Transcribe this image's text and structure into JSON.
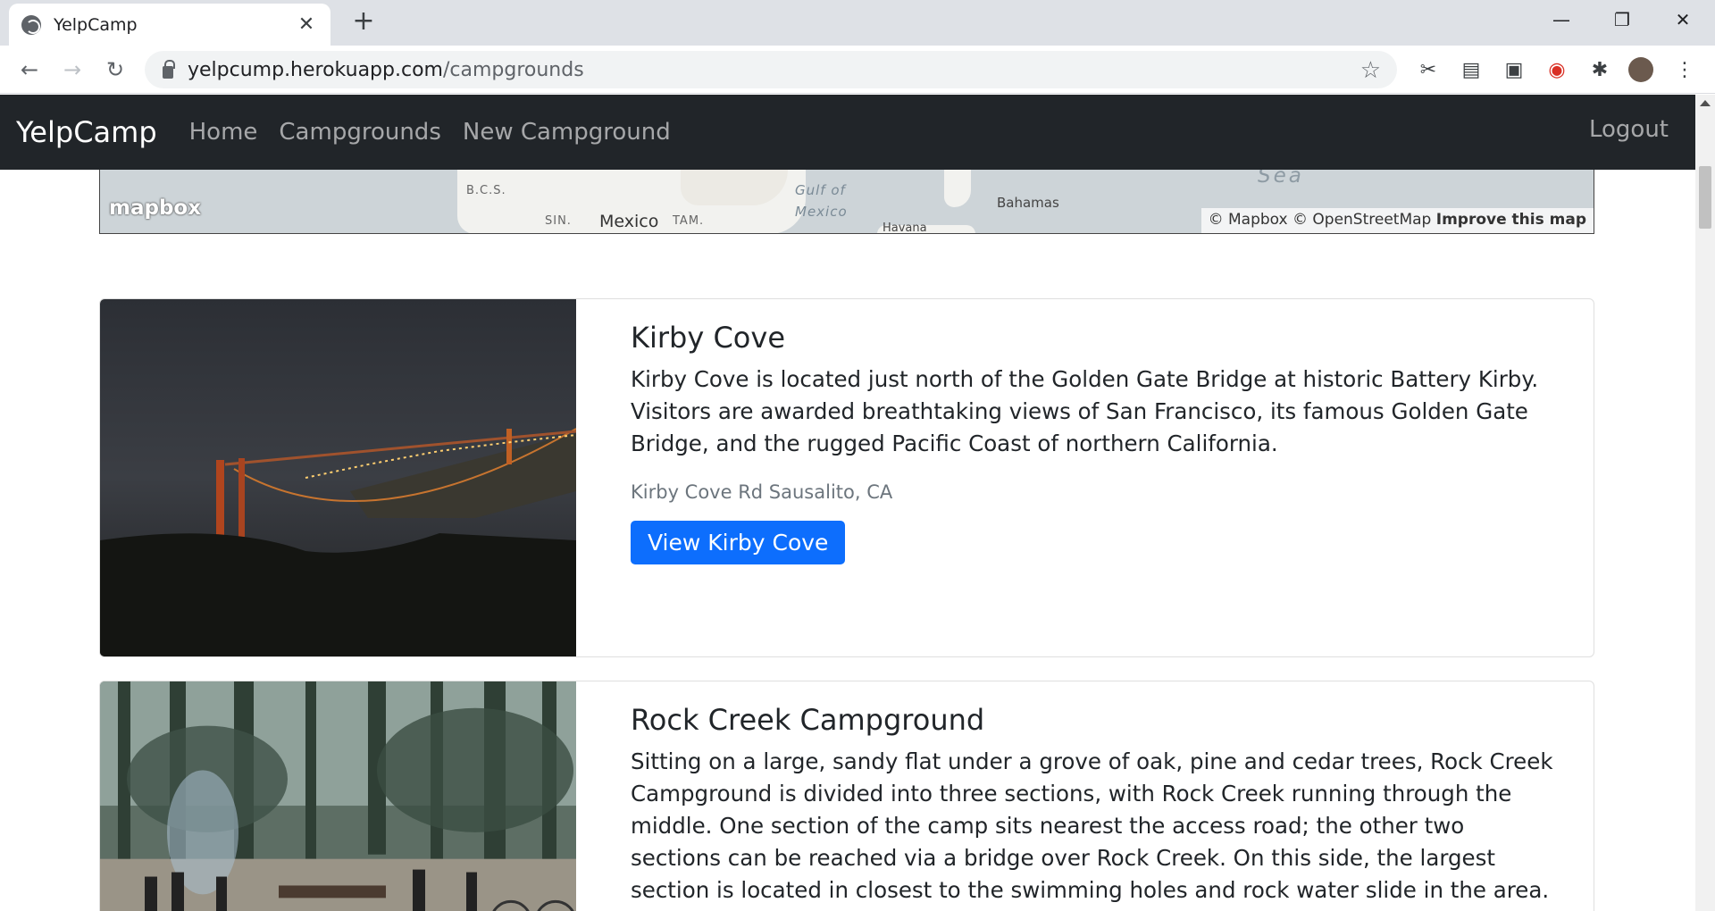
{
  "browser": {
    "tab_title": "YelpCamp",
    "url_host": "yelpcump.herokuapp.com",
    "url_path": "/campgrounds"
  },
  "navbar": {
    "brand": "YelpCamp",
    "links": [
      "Home",
      "Campgrounds",
      "New Campground"
    ],
    "logout": "Logout"
  },
  "map": {
    "labels": [
      "B.C.S.",
      "SIN.",
      "Mexico",
      "TAM.",
      "Gulf of",
      "Mexico",
      "Bahamas",
      "Havana",
      "Sea"
    ],
    "logo": "mapbox",
    "attribution": "© Mapbox © OpenStreetMap",
    "improve": "Improve this map"
  },
  "campgrounds": [
    {
      "title": "Kirby Cove",
      "description": "Kirby Cove is located just north of the Golden Gate Bridge at historic Battery Kirby. Visitors are awarded breathtaking views of San Francisco, its famous Golden Gate Bridge, and the rugged Pacific Coast of northern California.",
      "location": "Kirby Cove Rd Sausalito, CA",
      "button": "View Kirby Cove"
    },
    {
      "title": "Rock Creek Campground",
      "description": "Sitting on a large, sandy flat under a grove of oak, pine and cedar trees, Rock Creek Campground is divided into three sections, with Rock Creek running through the middle. One section of the camp sits nearest the access road; the other two sections can be reached via a bridge over Rock Creek. On this side, the largest section is located in closest to the swimming holes and rock water slide in the area. Each campsite has a picnic table"
    }
  ]
}
